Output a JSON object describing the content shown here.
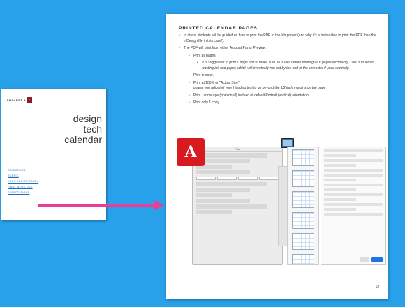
{
  "cover": {
    "project_label": "PROJECT 1",
    "badge": "▪",
    "title_lines": [
      "design",
      "tech",
      "calendar"
    ],
    "links": [
      "OBJECTIVES",
      "RUBRIC",
      "YOUR DESIGN STUDY",
      "FINAL WORK DUE",
      "EXPECTATIONS"
    ]
  },
  "doc": {
    "heading": "PRINTED CALENDAR PAGES",
    "bullets": [
      {
        "level": 1,
        "text": "In class, students will be guided on how to print the PDF to the lab printer (and why it's a better idea to print the PDF than the InDesign file in this case!)."
      },
      {
        "level": 1,
        "text": "The PDF will print from either Acrobat Pro or Preview."
      },
      {
        "level": 2,
        "text": "Print all pages."
      },
      {
        "level": 3,
        "text": "It is suggested to print 1 page first to make sure all is well before printing all 6 pages incorrectly. This is to avoid wasting ink and paper, which will eventually run out by the end of the semester if used unwisely."
      },
      {
        "level": 2,
        "text": "Print in color."
      },
      {
        "level": 2,
        "text": "Print at 100% or \"Actual Size\"",
        "sub": "unless you adjusted your Heading text to go beyond the 1/2 inch margins on the page"
      },
      {
        "level": 2,
        "text": "Print Landscape (horizontal) instead of default Portrait (vertical) orientation."
      },
      {
        "level": 2,
        "text": "Print only 1 copy."
      }
    ],
    "page_number": "12",
    "print_dialog_title": "Print",
    "pdf_icon_glyph": "A"
  },
  "colors": {
    "background": "#29a0ea",
    "arrow": "#e83e97",
    "badge": "#8a1e2e",
    "acrobat": "#d71920"
  }
}
